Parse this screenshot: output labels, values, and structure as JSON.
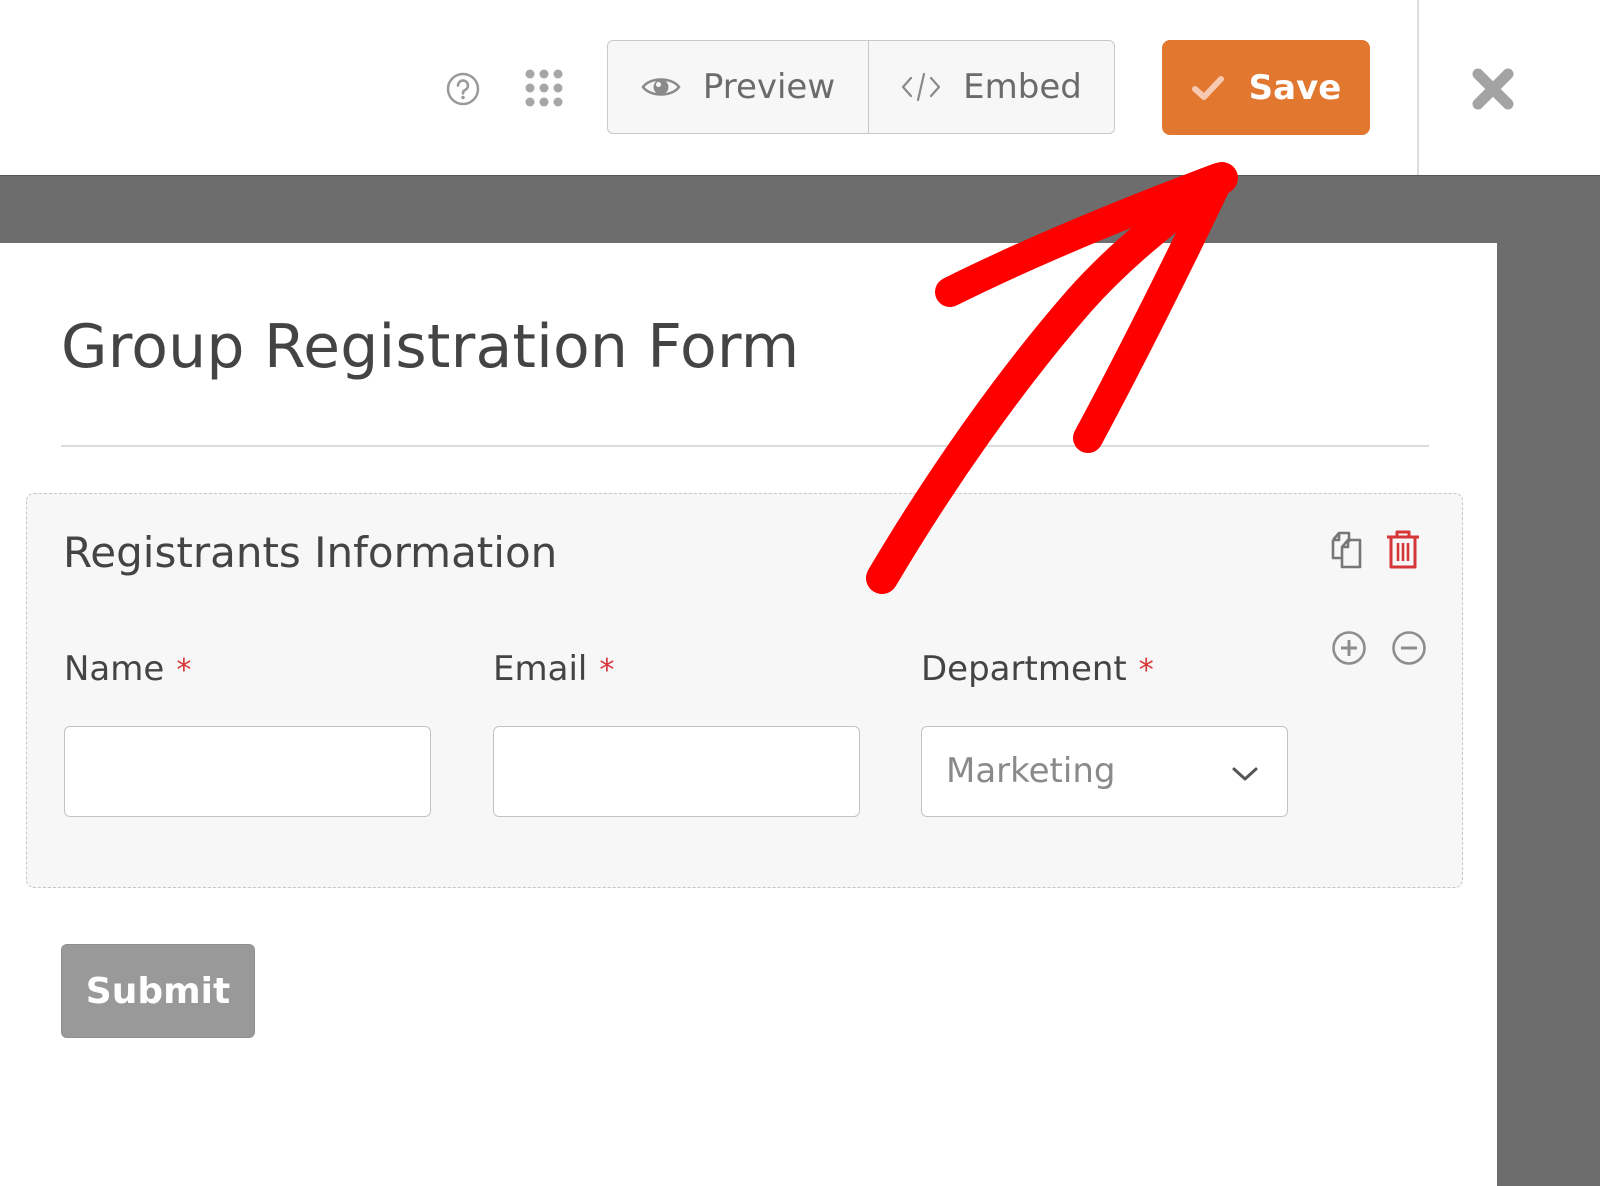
{
  "toolbar": {
    "help_icon": "question-circle-icon",
    "apps_icon": "grid-dots-icon",
    "preview_label": "Preview",
    "preview_icon": "eye-icon",
    "embed_label": "Embed",
    "embed_icon": "code-icon",
    "save_label": "Save",
    "save_icon": "check-icon",
    "close_icon": "x-icon",
    "save_color": "#e27730"
  },
  "form": {
    "title": "Group Registration Form",
    "section": {
      "title": "Registrants Information",
      "actions": [
        "duplicate-icon",
        "trash-icon",
        "plus-circle-icon",
        "minus-circle-icon"
      ],
      "fields": [
        {
          "label": "Name",
          "required_mark": "*",
          "type": "text",
          "value": ""
        },
        {
          "label": "Email",
          "required_mark": "*",
          "type": "email",
          "value": ""
        },
        {
          "label": "Department",
          "required_mark": "*",
          "type": "select",
          "value": "Marketing"
        }
      ]
    },
    "submit_label": "Submit"
  },
  "colors": {
    "accent": "#e27730",
    "required": "#d63638",
    "delete": "#d63638",
    "annotation": "#ff0000"
  }
}
